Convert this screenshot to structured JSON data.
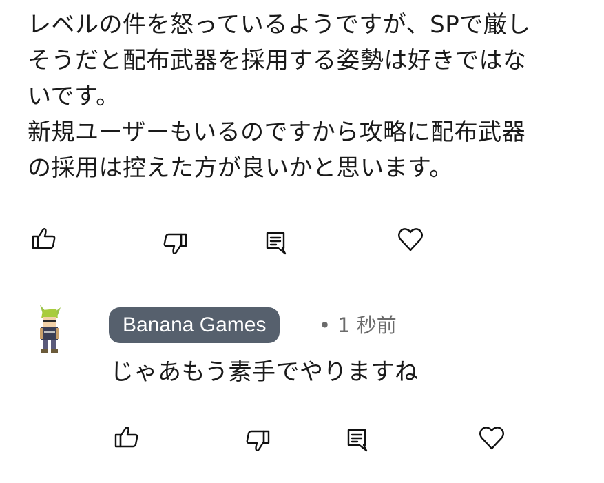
{
  "comment": {
    "lines": [
      "レベルの件を怒っているようですが、SPで厳し",
      "そうだと配布武器を採用する姿勢は好きではな",
      "いです。",
      "新規ユーザーもいるのですから攻略に配布武器",
      "の採用は控えた方が良いかと思います。"
    ],
    "actions": [
      "like-icon",
      "dislike-icon",
      "reply-icon",
      "heart-icon"
    ]
  },
  "reply": {
    "author": "Banana Games",
    "separator": "•",
    "time": "1 秒前",
    "text": "じゃあもう素手でやりますね",
    "actions": [
      "like-icon",
      "dislike-icon",
      "reply-icon",
      "heart-icon"
    ]
  }
}
